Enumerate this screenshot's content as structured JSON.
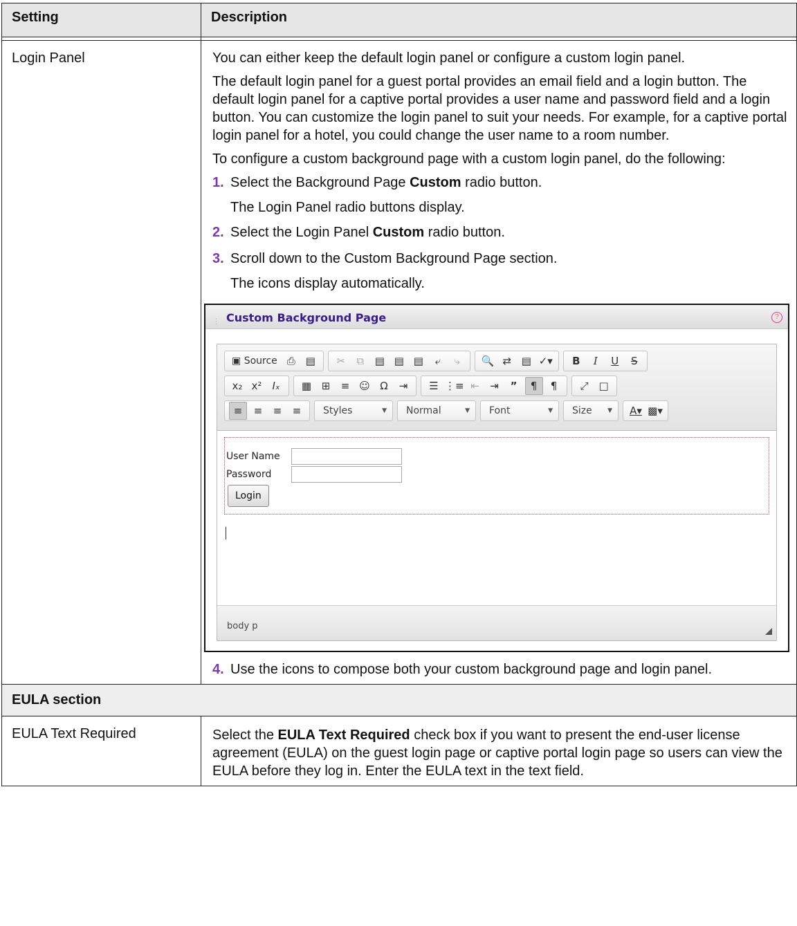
{
  "table": {
    "headers": [
      "Setting",
      "Description"
    ],
    "login_panel": {
      "setting": "Login Panel",
      "p1": "You can either keep the default login panel or configure a custom login panel.",
      "p2": "The default login panel for a guest portal provides an email field and a login button. The default login panel for a captive portal provides a user name and password field and a login button. You can customize the login panel to suit your needs. For example, for a captive portal login panel for a hotel, you could change the user name to a room number.",
      "p3": "To configure a custom background page with a custom login panel, do the following:",
      "steps": [
        {
          "num": "1.",
          "pre": "Select the Background Page ",
          "bold": "Custom",
          "post": " radio button.",
          "sub": "The Login Panel radio buttons display."
        },
        {
          "num": "2.",
          "pre": "Select the Login Panel ",
          "bold": "Custom",
          "post": " radio button.",
          "sub": ""
        },
        {
          "num": "3.",
          "pre": "Scroll down to the Custom Background Page section.",
          "bold": "",
          "post": "",
          "sub": "The icons display automatically."
        },
        {
          "num": "4.",
          "pre": "Use the icons to compose both your custom background page and login panel.",
          "bold": "",
          "post": "",
          "sub": ""
        }
      ]
    },
    "eula_section": "EULA section",
    "eula": {
      "setting": "EULA Text Required",
      "pre": "Select the ",
      "bold": "EULA Text Required",
      "post": " check box if you want to present the end-user license agreement (EULA) on the guest login page or captive portal login page so users can view the EULA before they log in. Enter the EULA text in the text field."
    }
  },
  "screenshot": {
    "title": "Custom Background Page",
    "help": "?",
    "toolbar": {
      "source_label": "Source",
      "styles": "Styles",
      "format": "Normal",
      "font": "Font",
      "size": "Size"
    },
    "login_form": {
      "user_name_label": "User Name",
      "password_label": "Password",
      "login_button": "Login"
    },
    "status_path": "body  p"
  }
}
